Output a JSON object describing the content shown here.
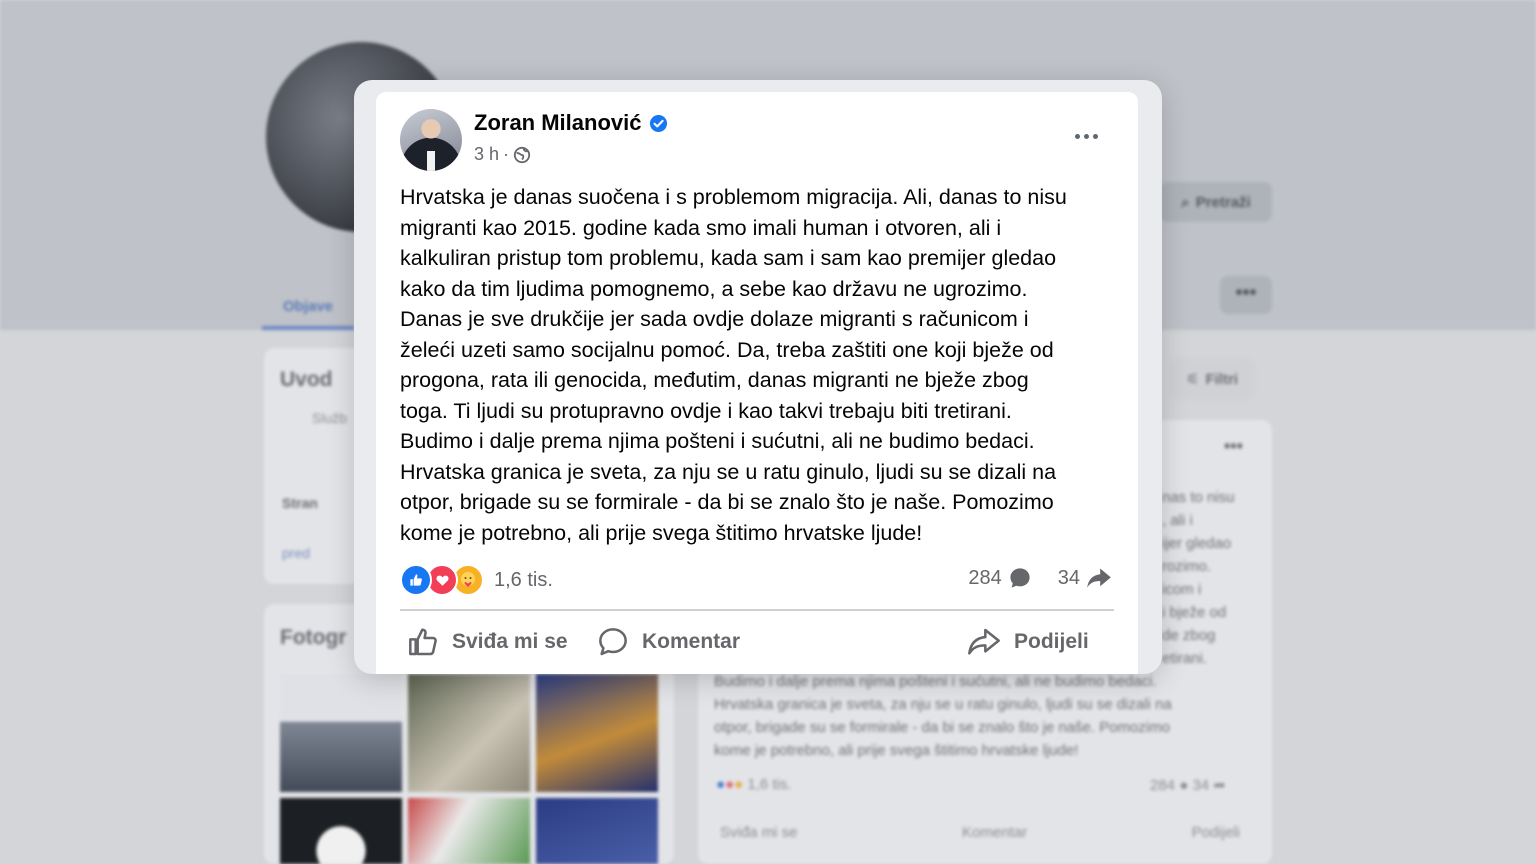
{
  "background": {
    "search_label": "Pretraži",
    "tab_active": "Objave",
    "more": "•••",
    "intro_title": "Uvod",
    "intro_sub": "Služb",
    "intro_row1": "Stran",
    "intro_row2": "pred",
    "photos_title": "Fotogr",
    "filter_label": "Filtri",
    "post_text_right": "nas to nisu\n, ali i\nijer gledao\nrozimo.\nicom i\ni bježe od\nde zbog\netirani.",
    "post_text_bottom": "Budimo i dalje prema njima pošteni i sućutni, ali ne budimo bedaci.\nHrvatska granica je sveta, za nju se u ratu ginulo, ljudi su se dizali na\notpor, brigade su se formirale - da bi se znalo što je naše. Pomozimo\nkome je potrebno, ali prije svega štitimo hrvatske ljude!",
    "reaction_count": "1,6 tis.",
    "comment_count": "284",
    "share_count": "34",
    "action_like": "Sviđa mi se",
    "action_comment": "Komentar",
    "action_share": "Podijeli"
  },
  "post": {
    "author": "Zoran Milanović",
    "verified": true,
    "time": "3 h",
    "separator": "·",
    "privacy_icon": "globe-icon",
    "text": "Hrvatska je danas suočena i s problemom migracija. Ali, danas to nisu\nmigranti kao 2015. godine kada smo imali human i otvoren, ali i\nkalkuliran pristup tom problemu, kada sam i sam kao premijer gledao\nkako da tim ljudima pomognemo, a sebe kao državu ne ugrozimo.\nDanas je sve drukčije jer sada ovdje dolaze migranti s računicom i\nželeći uzeti samo socijalnu pomoć. Da, treba zaštiti one koji bježe od\nprogona, rata ili genocida, međutim, danas migranti ne bježe zbog\ntoga. Ti ljudi su protupravno ovdje i kao takvi trebaju biti tretirani.\nBudimo i dalje prema njima pošteni i sućutni, ali ne budimo bedaci.\nHrvatska granica je sveta, za nju se u ratu ginulo, ljudi su se dizali na\notpor, brigade su se formirale - da bi se znalo što je naše. Pomozimo\nkome je potrebno, ali prije svega štitimo hrvatske ljude!",
    "reactions": [
      "like-icon",
      "love-icon",
      "care-icon"
    ],
    "reaction_count": "1,6 tis.",
    "comment_count": "284",
    "share_count": "34",
    "actions": {
      "like": "Sviđa mi se",
      "comment": "Komentar",
      "share": "Podijeli"
    }
  },
  "colors": {
    "brand_blue": "#1877f2",
    "text_secondary": "#65676b"
  }
}
